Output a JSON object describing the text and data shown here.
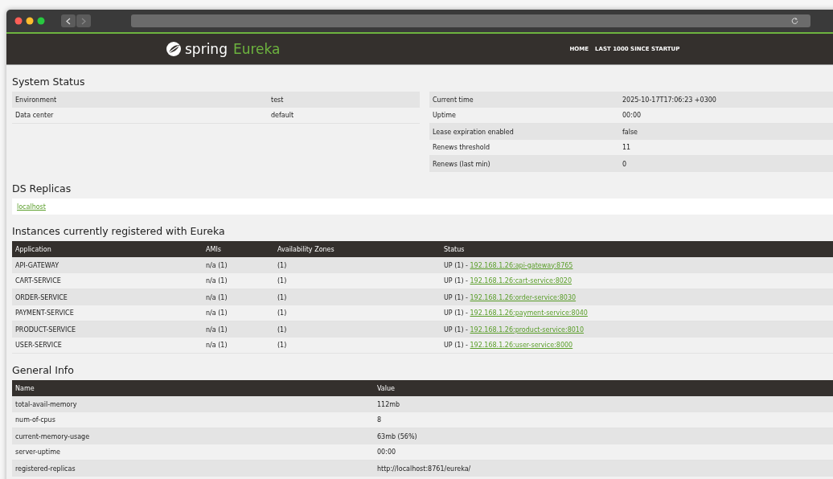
{
  "brand": {
    "word": "spring",
    "product": "Eureka"
  },
  "nav": [
    "HOME",
    "LAST 1000 SINCE STARTUP"
  ],
  "system_status": {
    "title": "System Status",
    "left": [
      {
        "label": "Environment",
        "value": "test"
      },
      {
        "label": "Data center",
        "value": "default"
      }
    ],
    "right": [
      {
        "label": "Current time",
        "value": "2025-10-17T17:06:23 +0300"
      },
      {
        "label": "Uptime",
        "value": "00:00"
      },
      {
        "label": "Lease expiration enabled",
        "value": "false"
      },
      {
        "label": "Renews threshold",
        "value": "11"
      },
      {
        "label": "Renews (last min)",
        "value": "0"
      }
    ]
  },
  "ds_replicas": {
    "title": "DS Replicas",
    "items": [
      "localhost"
    ]
  },
  "instances": {
    "title": "Instances currently registered with Eureka",
    "columns": [
      "Application",
      "AMIs",
      "Availability Zones",
      "Status"
    ],
    "rows": [
      {
        "application": "API-GATEWAY",
        "amis": "n/a (1)",
        "zones": "(1)",
        "status": "UP (1) - ",
        "link": "192.168.1.26:api-gateway:8765"
      },
      {
        "application": "CART-SERVICE",
        "amis": "n/a (1)",
        "zones": "(1)",
        "status": "UP (1) - ",
        "link": "192.168.1.26:cart-service:8020"
      },
      {
        "application": "ORDER-SERVICE",
        "amis": "n/a (1)",
        "zones": "(1)",
        "status": "UP (1) - ",
        "link": "192.168.1.26:order-service:8030"
      },
      {
        "application": "PAYMENT-SERVICE",
        "amis": "n/a (1)",
        "zones": "(1)",
        "status": "UP (1) - ",
        "link": "192.168.1.26:payment-service:8040"
      },
      {
        "application": "PRODUCT-SERVICE",
        "amis": "n/a (1)",
        "zones": "(1)",
        "status": "UP (1) - ",
        "link": "192.168.1.26:product-service:8010"
      },
      {
        "application": "USER-SERVICE",
        "amis": "n/a (1)",
        "zones": "(1)",
        "status": "UP (1) - ",
        "link": "192.168.1.26:user-service:8000"
      }
    ]
  },
  "general_info": {
    "title": "General Info",
    "columns": [
      "Name",
      "Value"
    ],
    "rows": [
      {
        "name": "total-avail-memory",
        "value": "112mb"
      },
      {
        "name": "num-of-cpus",
        "value": "8"
      },
      {
        "name": "current-memory-usage",
        "value": "63mb (56%)"
      },
      {
        "name": "server-uptime",
        "value": "00:00"
      },
      {
        "name": "registered-replicas",
        "value": "http://localhost:8761/eureka/"
      }
    ]
  }
}
